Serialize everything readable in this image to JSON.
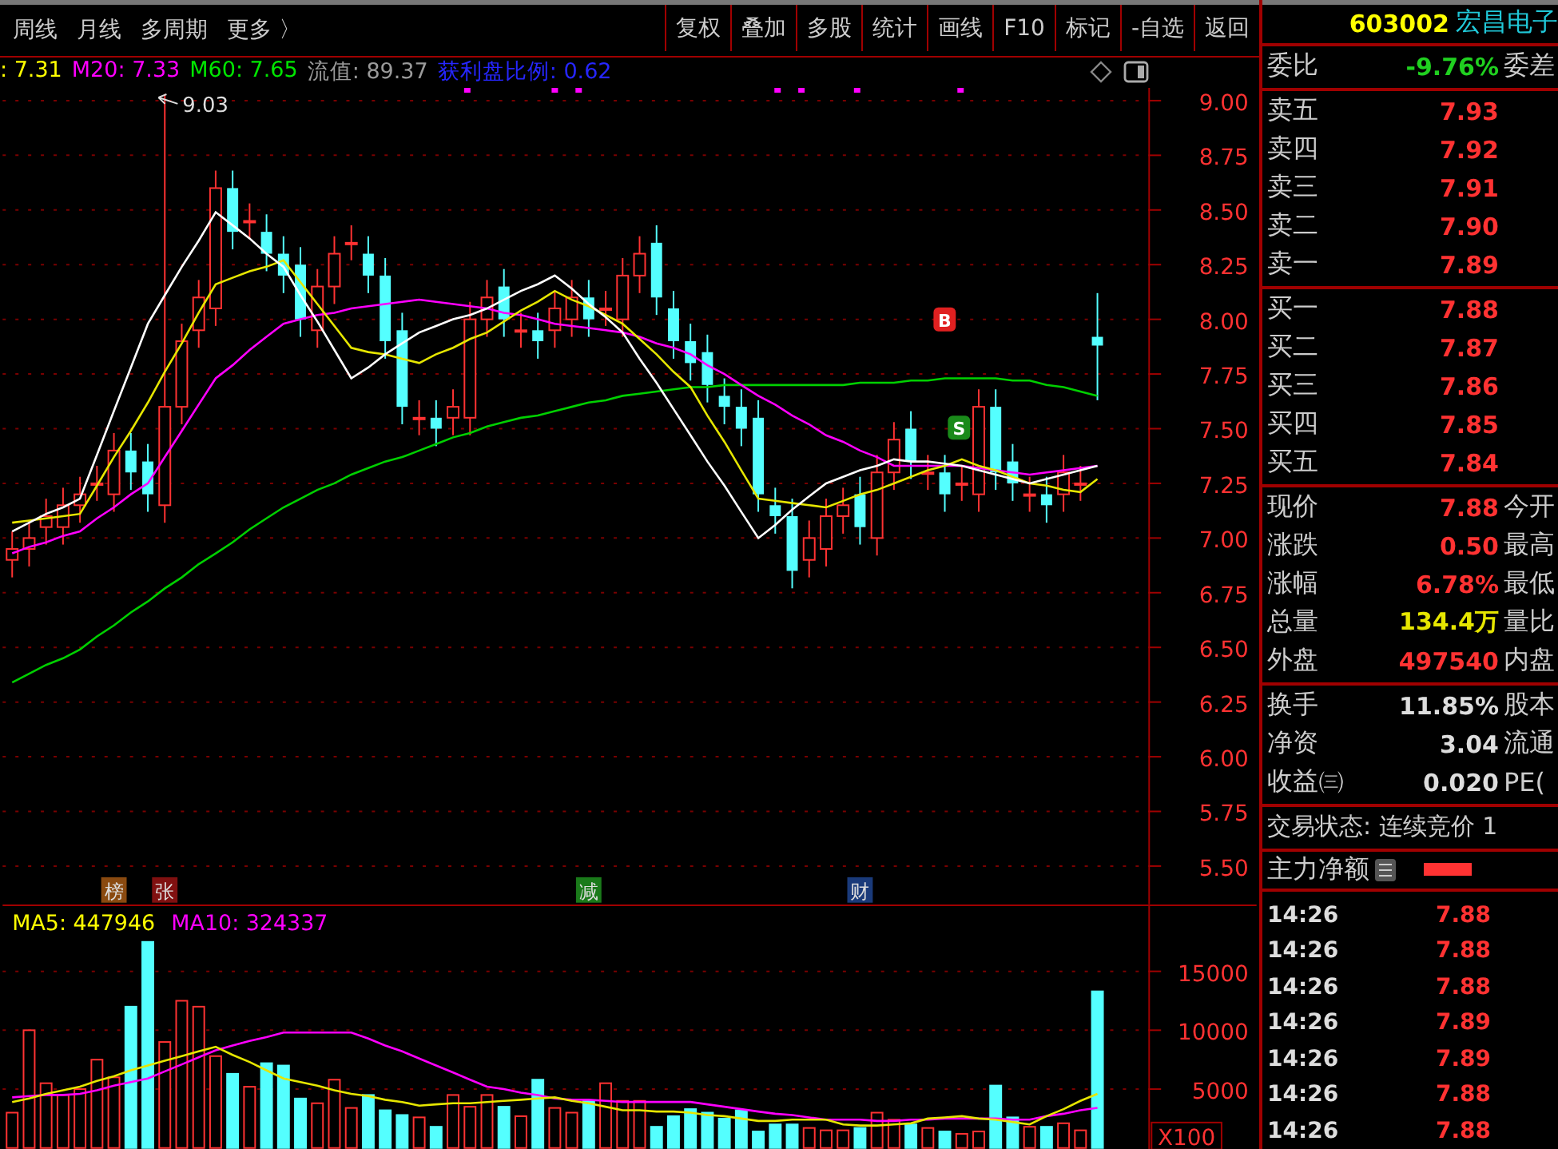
{
  "toolbar": {
    "tabs": [
      "周线",
      "月线",
      "多周期",
      "更多 〉"
    ],
    "buttons": [
      "复权",
      "叠加",
      "多股",
      "统计",
      "画线",
      "F10",
      "标记",
      "-自选",
      "返回"
    ]
  },
  "indicator_line": [
    {
      "text": ": 7.31",
      "color": "#ffff00"
    },
    {
      "text": "M20: 7.33",
      "color": "#ff00ff"
    },
    {
      "text": "M60: 7.65",
      "color": "#00e600"
    },
    {
      "text": "流值: 89.37",
      "color": "#9a9a9a"
    },
    {
      "text": "获利盘比例: 0.62",
      "color": "#2626ff"
    }
  ],
  "price_chart": {
    "high_label": "9.03",
    "chart_data": {
      "type": "candlestick",
      "grid": true,
      "ylim": [
        5.5,
        9.0
      ],
      "yticks": [
        {
          "value": 9.0,
          "label": "9.00"
        },
        {
          "value": 8.75,
          "label": "8.75"
        },
        {
          "value": 8.5,
          "label": "8.50"
        },
        {
          "value": 8.25,
          "label": "8.25"
        },
        {
          "value": 8.0,
          "label": "8.00"
        },
        {
          "value": 7.75,
          "label": "7.75"
        },
        {
          "value": 7.5,
          "label": "7.50"
        },
        {
          "value": 7.25,
          "label": "7.25"
        },
        {
          "value": 7.0,
          "label": "7.00"
        },
        {
          "value": 6.75,
          "label": "6.75"
        },
        {
          "value": 6.5,
          "label": "6.50"
        },
        {
          "value": 6.25,
          "label": "6.25"
        },
        {
          "value": 6.0,
          "label": "6.00"
        },
        {
          "value": 5.75,
          "label": "5.75"
        },
        {
          "value": 5.5,
          "label": "5.50"
        }
      ],
      "ohlc": [
        [
          6.9,
          7.03,
          6.82,
          6.95
        ],
        [
          6.95,
          7.08,
          6.87,
          7.0
        ],
        [
          7.05,
          7.18,
          6.97,
          7.1
        ],
        [
          7.05,
          7.23,
          6.97,
          7.15
        ],
        [
          7.15,
          7.28,
          7.07,
          7.2
        ],
        [
          7.25,
          7.33,
          7.17,
          7.25
        ],
        [
          7.2,
          7.48,
          7.12,
          7.4
        ],
        [
          7.4,
          7.48,
          7.22,
          7.3
        ],
        [
          7.35,
          7.43,
          7.12,
          7.2
        ],
        [
          7.15,
          9.03,
          7.07,
          7.6
        ],
        [
          7.6,
          7.98,
          7.52,
          7.9
        ],
        [
          7.95,
          8.18,
          7.87,
          8.1
        ],
        [
          8.05,
          8.68,
          7.97,
          8.6
        ],
        [
          8.6,
          8.68,
          8.32,
          8.4
        ],
        [
          8.45,
          8.53,
          8.37,
          8.45
        ],
        [
          8.4,
          8.48,
          8.22,
          8.3
        ],
        [
          8.3,
          8.38,
          8.12,
          8.2
        ],
        [
          8.25,
          8.33,
          7.92,
          8.0
        ],
        [
          7.95,
          8.23,
          7.87,
          8.15
        ],
        [
          8.15,
          8.38,
          8.07,
          8.3
        ],
        [
          8.35,
          8.43,
          8.27,
          8.35
        ],
        [
          8.3,
          8.38,
          8.12,
          8.2
        ],
        [
          8.2,
          8.28,
          7.82,
          7.9
        ],
        [
          7.95,
          8.03,
          7.52,
          7.6
        ],
        [
          7.55,
          7.63,
          7.47,
          7.55
        ],
        [
          7.55,
          7.63,
          7.42,
          7.5
        ],
        [
          7.55,
          7.68,
          7.47,
          7.6
        ],
        [
          7.55,
          8.08,
          7.47,
          8.0
        ],
        [
          8.0,
          8.18,
          7.92,
          8.1
        ],
        [
          8.15,
          8.23,
          7.92,
          8.0
        ],
        [
          7.95,
          8.03,
          7.87,
          7.95
        ],
        [
          7.95,
          8.03,
          7.82,
          7.9
        ],
        [
          7.95,
          8.13,
          7.87,
          8.05
        ],
        [
          8.0,
          8.18,
          7.92,
          8.1
        ],
        [
          8.1,
          8.18,
          7.92,
          8.0
        ],
        [
          8.05,
          8.13,
          7.97,
          8.05
        ],
        [
          8.0,
          8.28,
          7.92,
          8.2
        ],
        [
          8.2,
          8.38,
          8.12,
          8.3
        ],
        [
          8.35,
          8.43,
          8.02,
          8.1
        ],
        [
          8.05,
          8.13,
          7.82,
          7.9
        ],
        [
          7.9,
          7.98,
          7.72,
          7.8
        ],
        [
          7.85,
          7.93,
          7.62,
          7.7
        ],
        [
          7.65,
          7.73,
          7.52,
          7.6
        ],
        [
          7.6,
          7.68,
          7.42,
          7.5
        ],
        [
          7.55,
          7.63,
          7.12,
          7.2
        ],
        [
          7.15,
          7.23,
          7.02,
          7.1
        ],
        [
          7.1,
          7.18,
          6.77,
          6.85
        ],
        [
          6.9,
          7.08,
          6.82,
          7.0
        ],
        [
          6.95,
          7.18,
          6.87,
          7.1
        ],
        [
          7.1,
          7.23,
          7.02,
          7.15
        ],
        [
          7.2,
          7.28,
          6.97,
          7.05
        ],
        [
          7.0,
          7.38,
          6.92,
          7.3
        ],
        [
          7.3,
          7.53,
          7.22,
          7.45
        ],
        [
          7.5,
          7.58,
          7.27,
          7.35
        ],
        [
          7.3,
          7.38,
          7.22,
          7.3
        ],
        [
          7.3,
          7.38,
          7.12,
          7.2
        ],
        [
          7.25,
          7.33,
          7.17,
          7.25
        ],
        [
          7.2,
          7.68,
          7.12,
          7.6
        ],
        [
          7.6,
          7.68,
          7.22,
          7.3
        ],
        [
          7.35,
          7.43,
          7.17,
          7.25
        ],
        [
          7.2,
          7.28,
          7.12,
          7.2
        ],
        [
          7.2,
          7.28,
          7.07,
          7.15
        ],
        [
          7.2,
          7.38,
          7.12,
          7.3
        ],
        [
          7.25,
          7.33,
          7.17,
          7.25
        ],
        [
          7.92,
          8.12,
          7.63,
          7.88
        ]
      ],
      "series": [
        {
          "type": "line",
          "color": "#00d000",
          "values": [
            6.34,
            6.38,
            6.42,
            6.45,
            6.49,
            6.55,
            6.6,
            6.66,
            6.71,
            6.77,
            6.82,
            6.88,
            6.93,
            6.98,
            7.04,
            7.09,
            7.14,
            7.18,
            7.22,
            7.25,
            7.29,
            7.32,
            7.35,
            7.37,
            7.4,
            7.43,
            7.46,
            7.48,
            7.51,
            7.53,
            7.55,
            7.56,
            7.58,
            7.6,
            7.62,
            7.63,
            7.65,
            7.66,
            7.67,
            7.68,
            7.69,
            7.69,
            7.7,
            7.7,
            7.7,
            7.7,
            7.7,
            7.7,
            7.7,
            7.7,
            7.71,
            7.71,
            7.71,
            7.72,
            7.72,
            7.73,
            7.73,
            7.73,
            7.73,
            7.72,
            7.72,
            7.7,
            7.69,
            7.67,
            7.65
          ]
        },
        {
          "type": "line",
          "color": "#ff00ff",
          "values": [
            6.93,
            6.96,
            6.98,
            7.01,
            7.03,
            7.09,
            7.14,
            7.2,
            7.25,
            7.37,
            7.49,
            7.61,
            7.73,
            7.79,
            7.86,
            7.92,
            7.98,
            8.0,
            8.02,
            8.03,
            8.05,
            8.06,
            8.07,
            8.08,
            8.09,
            8.08,
            8.07,
            8.06,
            8.05,
            8.03,
            8.02,
            8.0,
            7.98,
            7.97,
            7.96,
            7.95,
            7.94,
            7.92,
            7.89,
            7.87,
            7.84,
            7.79,
            7.75,
            7.7,
            7.65,
            7.61,
            7.56,
            7.52,
            7.47,
            7.44,
            7.4,
            7.37,
            7.33,
            7.33,
            7.33,
            7.33,
            7.33,
            7.32,
            7.31,
            7.3,
            7.29,
            7.3,
            7.31,
            7.32,
            7.33
          ]
        },
        {
          "type": "line",
          "color": "#e6e600",
          "values": [
            7.07,
            7.08,
            7.09,
            7.1,
            7.11,
            7.24,
            7.37,
            7.49,
            7.62,
            7.76,
            7.89,
            8.03,
            8.16,
            8.19,
            8.22,
            8.24,
            8.27,
            8.17,
            8.07,
            7.97,
            7.87,
            7.85,
            7.84,
            7.82,
            7.8,
            7.84,
            7.87,
            7.91,
            7.94,
            7.99,
            8.04,
            8.08,
            8.13,
            8.09,
            8.06,
            8.02,
            7.98,
            7.91,
            7.84,
            7.76,
            7.69,
            7.56,
            7.44,
            7.31,
            7.18,
            7.17,
            7.16,
            7.15,
            7.14,
            7.17,
            7.2,
            7.22,
            7.25,
            7.28,
            7.31,
            7.33,
            7.36,
            7.33,
            7.31,
            7.28,
            7.25,
            7.24,
            7.22,
            7.21,
            7.27
          ]
        },
        {
          "type": "line",
          "color": "#ffffff",
          "values": [
            7.03,
            7.07,
            7.11,
            7.14,
            7.18,
            7.38,
            7.58,
            7.78,
            7.98,
            8.11,
            8.24,
            8.36,
            8.49,
            8.43,
            8.37,
            8.3,
            8.24,
            8.11,
            7.99,
            7.86,
            7.73,
            7.78,
            7.84,
            7.89,
            7.94,
            7.97,
            8.0,
            8.02,
            8.05,
            8.09,
            8.13,
            8.16,
            8.2,
            8.14,
            8.07,
            8.01,
            7.94,
            7.82,
            7.71,
            7.59,
            7.47,
            7.35,
            7.24,
            7.12,
            7.0,
            7.06,
            7.13,
            7.19,
            7.25,
            7.28,
            7.31,
            7.33,
            7.36,
            7.35,
            7.35,
            7.34,
            7.33,
            7.31,
            7.29,
            7.27,
            7.25,
            7.27,
            7.29,
            7.31,
            7.33
          ]
        }
      ]
    },
    "signals": [
      {
        "text": "B",
        "color": "#e02020"
      },
      {
        "text": "S",
        "color": "#1a8a1a"
      }
    ],
    "event_tags": [
      {
        "text": "榜",
        "color": "#8a4a10"
      },
      {
        "text": "张",
        "color": "#801010"
      },
      {
        "text": "减",
        "color": "#1a7a1a"
      },
      {
        "text": "财",
        "color": "#1a3a7a"
      }
    ]
  },
  "volume_chart": {
    "ma_labels": [
      {
        "text": "MA5: 447946",
        "color": "#ffff00"
      },
      {
        "text": "MA10: 324337",
        "color": "#ff00ff"
      }
    ],
    "chart_data": {
      "type": "bar",
      "grid": true,
      "ylim": [
        0,
        20675
      ],
      "yticks": [
        {
          "value": 15000,
          "label": "15000"
        },
        {
          "value": 10000,
          "label": "10000"
        },
        {
          "value": 5000,
          "label": "5000"
        }
      ],
      "series": [
        {
          "type": "bar",
          "colors": [
            "#ff3232",
            "#ff3232",
            "#ff3232",
            "#ff3232",
            "#ff3232",
            "#ff3232",
            "#ff3232",
            "#54ffff",
            "#54ffff",
            "#ff3232",
            "#ff3232",
            "#ff3232",
            "#ff3232",
            "#54ffff",
            "#ff3232",
            "#54ffff",
            "#54ffff",
            "#54ffff",
            "#ff3232",
            "#ff3232",
            "#ff3232",
            "#54ffff",
            "#54ffff",
            "#54ffff",
            "#ff3232",
            "#54ffff",
            "#ff3232",
            "#ff3232",
            "#ff3232",
            "#54ffff",
            "#ff3232",
            "#54ffff",
            "#ff3232",
            "#ff3232",
            "#54ffff",
            "#ff3232",
            "#ff3232",
            "#ff3232",
            "#54ffff",
            "#54ffff",
            "#54ffff",
            "#54ffff",
            "#54ffff",
            "#54ffff",
            "#54ffff",
            "#54ffff",
            "#54ffff",
            "#ff3232",
            "#ff3232",
            "#ff3232",
            "#54ffff",
            "#ff3232",
            "#ff3232",
            "#54ffff",
            "#ff3232",
            "#54ffff",
            "#ff3232",
            "#ff3232",
            "#54ffff",
            "#54ffff",
            "#ff3232",
            "#54ffff",
            "#ff3232",
            "#ff3232",
            "#54ffff"
          ],
          "values": [
            3000,
            10000,
            5500,
            4500,
            5000,
            7500,
            6000,
            12000,
            17500,
            9000,
            12500,
            12000,
            7800,
            6300,
            5200,
            7200,
            7000,
            4200,
            3800,
            5800,
            3400,
            4500,
            3200,
            2800,
            2600,
            1800,
            4500,
            3500,
            4500,
            3500,
            2700,
            5800,
            3400,
            3000,
            4000,
            5500,
            4000,
            4000,
            1800,
            2700,
            3300,
            3000,
            2500,
            3200,
            1400,
            2000,
            2000,
            1700,
            1500,
            1500,
            1700,
            3000,
            2400,
            2000,
            1700,
            1400,
            1200,
            1400,
            5300,
            2600,
            1800,
            1800,
            2100,
            1500,
            13300
          ]
        },
        {
          "type": "line",
          "color": "#ff00ff",
          "values": [
            4300,
            4400,
            4500,
            4500,
            4600,
            4900,
            5300,
            5600,
            5900,
            6500,
            7100,
            7700,
            8300,
            8700,
            9100,
            9400,
            9800,
            9800,
            9800,
            9800,
            9800,
            9300,
            8700,
            8200,
            7600,
            7000,
            6400,
            5800,
            5200,
            5000,
            4700,
            4500,
            4200,
            4100,
            4100,
            4000,
            3900,
            3900,
            3900,
            3900,
            3900,
            3700,
            3500,
            3300,
            3100,
            2900,
            2800,
            2600,
            2400,
            2400,
            2400,
            2300,
            2300,
            2400,
            2400,
            2500,
            2500,
            2500,
            2500,
            2400,
            2400,
            2700,
            2900,
            3200,
            3400
          ]
        },
        {
          "type": "line",
          "color": "#e6e600",
          "values": [
            3900,
            4200,
            4600,
            4900,
            5200,
            5700,
            6100,
            6600,
            7000,
            7400,
            7800,
            8200,
            8600,
            7900,
            7300,
            6600,
            5900,
            5600,
            5300,
            4900,
            4600,
            4400,
            4100,
            3900,
            3600,
            3700,
            3800,
            3800,
            3900,
            4000,
            4100,
            4200,
            4300,
            4000,
            3800,
            3500,
            3200,
            3200,
            3100,
            3100,
            3000,
            2800,
            2700,
            2500,
            2300,
            2300,
            2400,
            2400,
            2400,
            2000,
            1900,
            1900,
            2000,
            2100,
            2500,
            2600,
            2700,
            2500,
            2400,
            2200,
            2000,
            2700,
            3300,
            4000,
            4600
          ]
        }
      ]
    },
    "unit": "X100"
  },
  "quote_panel": {
    "code": "603002",
    "name": "宏昌电子",
    "ratio": {
      "label": "委比",
      "value": "-9.76%",
      "label2": "委差"
    },
    "asks": [
      {
        "label": "卖五",
        "price": "7.93"
      },
      {
        "label": "卖四",
        "price": "7.92"
      },
      {
        "label": "卖三",
        "price": "7.91"
      },
      {
        "label": "卖二",
        "price": "7.90"
      },
      {
        "label": "卖一",
        "price": "7.89"
      }
    ],
    "bids": [
      {
        "label": "买一",
        "price": "7.88"
      },
      {
        "label": "买二",
        "price": "7.87"
      },
      {
        "label": "买三",
        "price": "7.86"
      },
      {
        "label": "买四",
        "price": "7.85"
      },
      {
        "label": "买五",
        "price": "7.84"
      }
    ],
    "quotes": [
      {
        "label": "现价",
        "value": "7.88",
        "label2": "今开",
        "color": "#ff3232"
      },
      {
        "label": "涨跌",
        "value": "0.50",
        "label2": "最高",
        "color": "#ff3232"
      },
      {
        "label": "涨幅",
        "value": "6.78%",
        "label2": "最低",
        "color": "#ff3232"
      },
      {
        "label": "总量",
        "value": "134.4万",
        "label2": "量比",
        "color": "#e6e600"
      },
      {
        "label": "外盘",
        "value": "497540",
        "label2": "内盘",
        "color": "#ff3232"
      }
    ],
    "stats": [
      {
        "label": "换手",
        "value": "11.85%",
        "label2": "股本"
      },
      {
        "label": "净资",
        "value": "3.04",
        "label2": "流通"
      },
      {
        "label": "收益㈢",
        "value": "0.020",
        "label2": "PE("
      }
    ],
    "status": "交易状态: 连续竞价 1",
    "main_force": {
      "label": "主力净额"
    },
    "trades": [
      {
        "time": "14:26",
        "price": "7.88"
      },
      {
        "time": "14:26",
        "price": "7.88"
      },
      {
        "time": "14:26",
        "price": "7.88"
      },
      {
        "time": "14:26",
        "price": "7.89"
      },
      {
        "time": "14:26",
        "price": "7.89"
      },
      {
        "time": "14:26",
        "price": "7.88"
      },
      {
        "time": "14:26",
        "price": "7.88"
      }
    ]
  }
}
